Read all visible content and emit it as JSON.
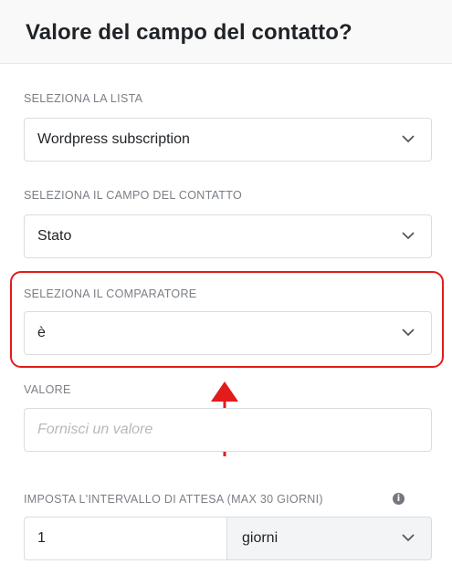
{
  "header": {
    "title": "Valore del campo del contatto?"
  },
  "list_field": {
    "label": "SELEZIONA LA LISTA",
    "value": "Wordpress subscription"
  },
  "contact_field": {
    "label": "SELEZIONA IL CAMPO DEL CONTATTO",
    "value": "Stato"
  },
  "comparator_field": {
    "label": "SELEZIONA IL COMPARATORE",
    "value": "è"
  },
  "value_field": {
    "label": "VALORE",
    "placeholder": "Fornisci un valore",
    "value": ""
  },
  "wait_interval": {
    "label": "IMPOSTA L'INTERVALLO DI ATTESA (MAX 30 GIORNI)",
    "info_glyph": "i",
    "amount": "1",
    "unit": "giorni"
  },
  "colors": {
    "highlight": "#e31b1b",
    "text": "#1f2327",
    "label": "#7a7f85"
  },
  "icons": {
    "dropdown": "chevron-down-icon",
    "info": "info-icon",
    "annotation": "arrow-up-icon"
  }
}
